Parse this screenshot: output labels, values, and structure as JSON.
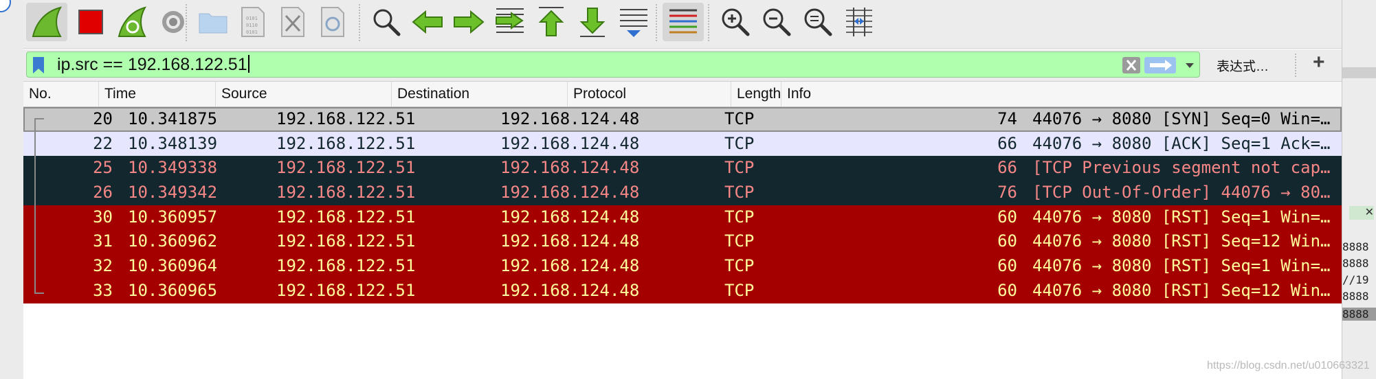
{
  "filter": {
    "value": "ip.src == 192.168.122.51",
    "expression_label": "表达式…",
    "add_label": "+"
  },
  "toolbar": {
    "buttons": [
      "start-capture",
      "stop-capture",
      "restart-capture",
      "capture-options",
      "open-file",
      "save-file",
      "close-file",
      "reload-file",
      "find-packet",
      "go-back",
      "go-forward",
      "go-to-packet",
      "go-first",
      "go-last",
      "auto-scroll",
      "colorize",
      "zoom-in",
      "zoom-out",
      "zoom-normal",
      "resize-columns"
    ]
  },
  "columns": [
    "No.",
    "Time",
    "Source",
    "Destination",
    "Protocol",
    "Length",
    "Info"
  ],
  "packets": [
    {
      "no": "20",
      "time": "10.341875",
      "source": "192.168.122.51",
      "destination": "192.168.124.48",
      "protocol": "TCP",
      "length": "74",
      "info": "44076 → 8080 [SYN] Seq=0 Win=…",
      "style": "selected"
    },
    {
      "no": "22",
      "time": "10.348139",
      "source": "192.168.122.51",
      "destination": "192.168.124.48",
      "protocol": "TCP",
      "length": "66",
      "info": "44076 → 8080 [ACK] Seq=1 Ack=…",
      "style": "light"
    },
    {
      "no": "25",
      "time": "10.349338",
      "source": "192.168.122.51",
      "destination": "192.168.124.48",
      "protocol": "TCP",
      "length": "66",
      "info": "[TCP Previous segment not cap…",
      "style": "dark"
    },
    {
      "no": "26",
      "time": "10.349342",
      "source": "192.168.122.51",
      "destination": "192.168.124.48",
      "protocol": "TCP",
      "length": "76",
      "info": "[TCP Out-Of-Order] 44076 → 80…",
      "style": "dark"
    },
    {
      "no": "30",
      "time": "10.360957",
      "source": "192.168.122.51",
      "destination": "192.168.124.48",
      "protocol": "TCP",
      "length": "60",
      "info": "44076 → 8080 [RST] Seq=1 Win=…",
      "style": "red"
    },
    {
      "no": "31",
      "time": "10.360962",
      "source": "192.168.122.51",
      "destination": "192.168.124.48",
      "protocol": "TCP",
      "length": "60",
      "info": "44076 → 8080 [RST] Seq=12 Win…",
      "style": "red"
    },
    {
      "no": "32",
      "time": "10.360964",
      "source": "192.168.122.51",
      "destination": "192.168.124.48",
      "protocol": "TCP",
      "length": "60",
      "info": "44076 → 8080 [RST] Seq=1 Win=…",
      "style": "red"
    },
    {
      "no": "33",
      "time": "10.360965",
      "source": "192.168.122.51",
      "destination": "192.168.124.48",
      "protocol": "TCP",
      "length": "60",
      "info": "44076 → 8080 [RST] Seq=12 Win…",
      "style": "red"
    }
  ],
  "background_edge": [
    "8888",
    "8888",
    "//19",
    "8888",
    "8888"
  ],
  "watermark": "https://blog.csdn.net/u010663321",
  "colors": {
    "filter_valid": "#afffaf",
    "row_red": "#a40000",
    "row_dark": "#12272e",
    "row_light": "#e7e6ff"
  }
}
